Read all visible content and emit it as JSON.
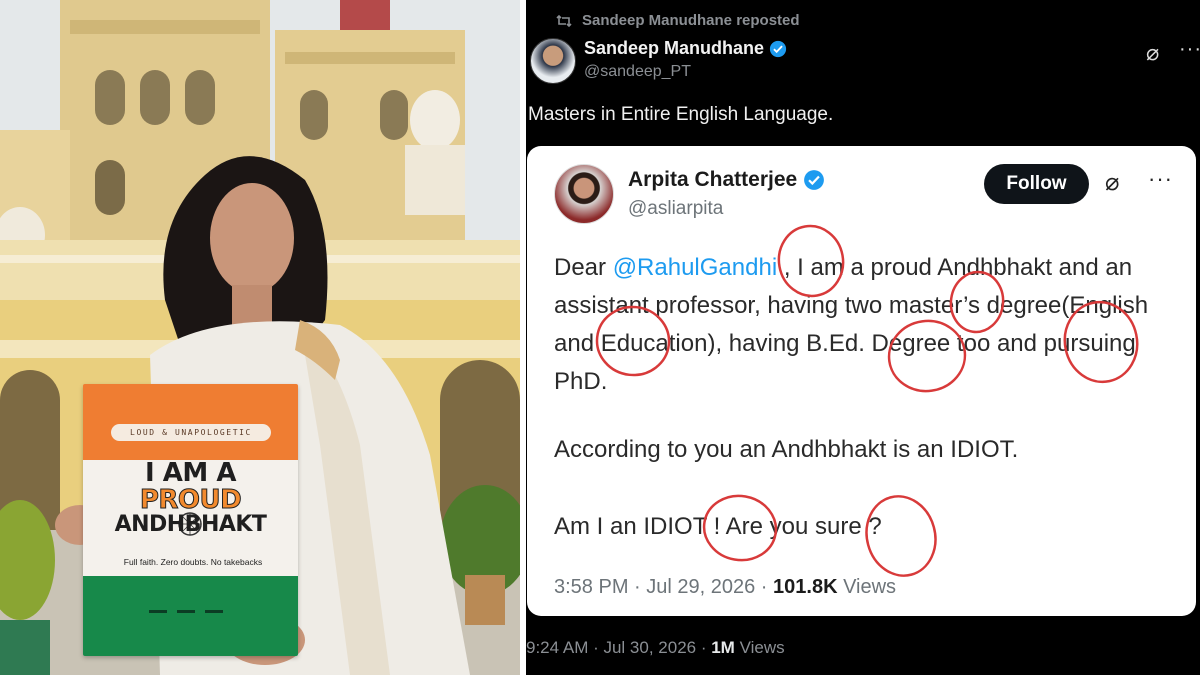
{
  "sign": {
    "tagline": "LOUD & UNAPOLOGETIC",
    "line1": "I AM A",
    "line2": "PROUD",
    "line3": "ANDHBHAKT",
    "small": "Full faith. Zero doubts. No takebacks"
  },
  "repost": {
    "label": "Sandeep Manudhane reposted"
  },
  "main_tweet": {
    "name": "Sandeep Manudhane",
    "handle": "@sandeep_PT",
    "text": "Masters in Entire English Language.",
    "time": "9:24 AM · Jul 30, 2026 · ",
    "views_count": "1M",
    "views_label": " Views"
  },
  "quoted_tweet": {
    "name": "Arpita Chatterjee",
    "handle": "@asliarpita",
    "follow_label": "Follow",
    "body_prefix": "Dear ",
    "mention": "@RahulGandhi",
    "body_rest": " , I am a proud Andhbhakt and an assistant professor, having two master’s degree(English and Education), having B.Ed. Degree too and pursuing PhD.",
    "para2": "According to you an Andhbhakt is an IDIOT.",
    "para3": "Am I an IDIOT ! Are you sure ?",
    "time": "3:58 PM · Jul 29, 2026 · ",
    "views_count": "101.8K",
    "views_label": " Views"
  },
  "colors": {
    "accent_blue": "#1d9bf0",
    "annotation_red": "#d83a3a",
    "saffron": "#ef7d32",
    "green": "#17894a"
  },
  "icons": [
    "repost-icon",
    "verified-badge-icon",
    "grok-icon",
    "more-icon"
  ]
}
